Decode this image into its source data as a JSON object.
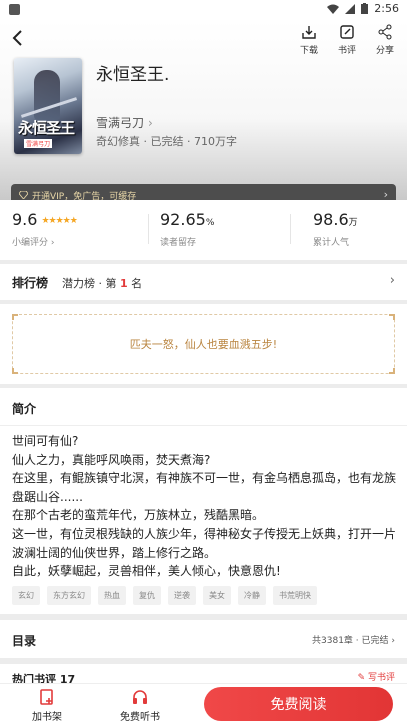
{
  "status_bar": {
    "time": "2:56"
  },
  "header": {
    "actions": [
      {
        "label": "下载",
        "icon": "download-icon"
      },
      {
        "label": "书评",
        "icon": "edit-review-icon"
      },
      {
        "label": "分享",
        "icon": "share-icon"
      }
    ]
  },
  "book": {
    "title": "永恒圣王.",
    "author": "雪满弓刀",
    "meta": "奇幻修真 · 已完结 · 710万字",
    "cover_text": "永恒圣王",
    "cover_sub": "雪满弓刀",
    "vip_text": "开通VIP，免广告，可缓存"
  },
  "stats": {
    "score": "9.6",
    "score_label": "小编评分",
    "retention": "92.65",
    "retention_unit": "%",
    "retention_label": "读者留存",
    "popularity": "98.6",
    "popularity_unit": "万",
    "popularity_label": "累计人气"
  },
  "rank": {
    "heading": "排行榜",
    "list": "潜力榜 · 第",
    "position": "1",
    "suffix": " 名"
  },
  "quote": "匹夫一怒，仙人也要血溅五步!",
  "intro": {
    "heading": "简介",
    "lines": [
      "世间可有仙?",
      "仙人之力，真能呼风唤雨，焚天煮海?",
      "在这里，有鲲族镇守北溟，有神族不可一世，有金乌栖息孤岛，也有龙族盘踞山谷......",
      "在那个古老的蛮荒年代，万族林立，残酷黑暗。",
      "这一世，有位灵根残缺的人族少年，得神秘女子传授无上妖典，打开一片波澜壮阔的仙侠世界，踏上修行之路。",
      "自此，妖孽崛起，灵兽相伴，美人倾心，快意恩仇!"
    ],
    "tags": [
      "玄幻",
      "东方玄幻",
      "热血",
      "复仇",
      "逆袭",
      "美女",
      "冷静",
      "书荒明快"
    ]
  },
  "toc": {
    "heading": "目录",
    "summary": "共3381章 · 已完结"
  },
  "hot_reviews": {
    "heading": "热门书评 17",
    "write": "写书评"
  },
  "bottom_bar": {
    "shelf_label": "加书架",
    "listen_label": "免费听书",
    "read_label": "免费阅读"
  },
  "colors": {
    "accent": "#e23b3b",
    "star": "#f5a623",
    "quote": "#b9843f"
  }
}
